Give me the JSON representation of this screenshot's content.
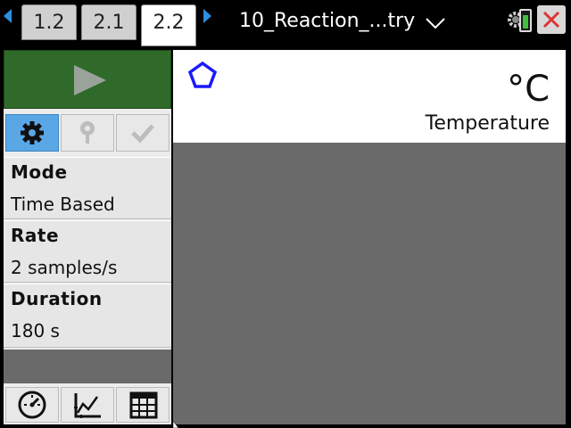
{
  "tabs": [
    {
      "label": "1.2",
      "active": false
    },
    {
      "label": "2.1",
      "active": false
    },
    {
      "label": "2.2",
      "active": true
    }
  ],
  "document_title": "10_Reaction_...try",
  "battery_level": 0.7,
  "colors": {
    "accent": "#2e8fe0",
    "play_bg": "#2f6a2a",
    "selected_tool": "#5aa7e6",
    "close_x": "#d33",
    "sensor_icon": "#1a1aff",
    "graph_area": "#6a6a6a"
  },
  "toolbar": {
    "play_icon": "play-icon",
    "tools": [
      "gear-icon",
      "pin-icon",
      "check-icon"
    ]
  },
  "settings": [
    {
      "label": "Mode",
      "value": "Time Based"
    },
    {
      "label": "Rate",
      "value": "2 samples/s"
    },
    {
      "label": "Duration",
      "value": "180 s"
    }
  ],
  "views": [
    "meter-icon",
    "graph-icon",
    "table-icon"
  ],
  "meter": {
    "unit": "°C",
    "sensor": "Temperature",
    "icon": "pentagon-icon"
  }
}
